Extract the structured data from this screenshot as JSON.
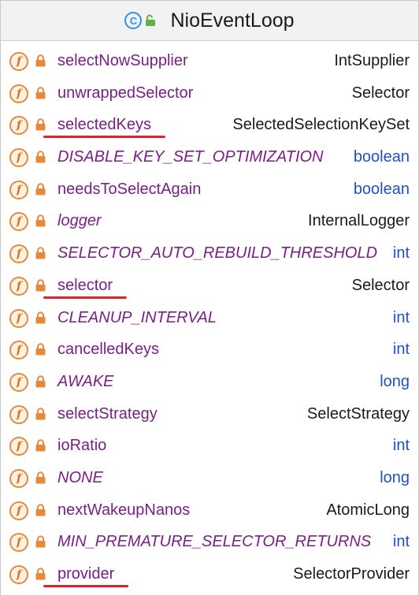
{
  "header": {
    "title": "NioEventLoop",
    "class_icon_letter": "C"
  },
  "field_icon_letter": "f",
  "fields": [
    {
      "name": "selectNowSupplier",
      "type": "IntSupplier",
      "italic": false,
      "primitive": false,
      "underlined": false
    },
    {
      "name": "unwrappedSelector",
      "type": "Selector",
      "italic": false,
      "primitive": false,
      "underlined": false
    },
    {
      "name": "selectedKeys",
      "type": "SelectedSelectionKeySet",
      "italic": false,
      "primitive": false,
      "underlined": true
    },
    {
      "name": "DISABLE_KEY_SET_OPTIMIZATION",
      "type": "boolean",
      "italic": true,
      "primitive": true,
      "underlined": false
    },
    {
      "name": "needsToSelectAgain",
      "type": "boolean",
      "italic": false,
      "primitive": true,
      "underlined": false
    },
    {
      "name": "logger",
      "type": "InternalLogger",
      "italic": true,
      "primitive": false,
      "underlined": false
    },
    {
      "name": "SELECTOR_AUTO_REBUILD_THRESHOLD",
      "type": "int",
      "italic": true,
      "primitive": true,
      "underlined": false
    },
    {
      "name": "selector",
      "type": "Selector",
      "italic": false,
      "primitive": false,
      "underlined": true
    },
    {
      "name": "CLEANUP_INTERVAL",
      "type": "int",
      "italic": true,
      "primitive": true,
      "underlined": false
    },
    {
      "name": "cancelledKeys",
      "type": "int",
      "italic": false,
      "primitive": true,
      "underlined": false
    },
    {
      "name": "AWAKE",
      "type": "long",
      "italic": true,
      "primitive": true,
      "underlined": false
    },
    {
      "name": "selectStrategy",
      "type": "SelectStrategy",
      "italic": false,
      "primitive": false,
      "underlined": false
    },
    {
      "name": "ioRatio",
      "type": "int",
      "italic": false,
      "primitive": true,
      "underlined": false
    },
    {
      "name": "NONE",
      "type": "long",
      "italic": true,
      "primitive": true,
      "underlined": false
    },
    {
      "name": "nextWakeupNanos",
      "type": "AtomicLong",
      "italic": false,
      "primitive": false,
      "underlined": false
    },
    {
      "name": "MIN_PREMATURE_SELECTOR_RETURNS",
      "type": "int",
      "italic": true,
      "primitive": true,
      "underlined": false
    },
    {
      "name": "provider",
      "type": "SelectorProvider",
      "italic": false,
      "primitive": false,
      "underlined": true
    }
  ],
  "colors": {
    "field_name": "#7a1f86",
    "primitive_type": "#1d52c4",
    "reference_type": "#1a1a1a",
    "field_icon": "#e8883a",
    "lock_icon": "#e8883a",
    "class_icon": "#3a8fd8",
    "underline": "#e0202a"
  }
}
